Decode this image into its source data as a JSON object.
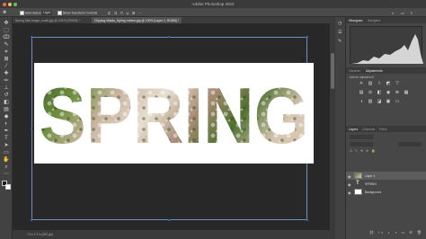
{
  "app": {
    "title": "Adobe Photoshop 2022"
  },
  "options_bar": {
    "auto_select_label": "Auto-Select:",
    "auto_select_value": "Layer",
    "transform_label": "Show Transform Controls"
  },
  "tabs": [
    {
      "label": "Spring Mist image_small.jpg @ 100% (RGB/8) *"
    },
    {
      "label": "Clipping Masks_Spring Letters.jpg @ 100% (Layer 1, RGB/8) *"
    }
  ],
  "document": {
    "text": "SPRING",
    "photo_fill_colors": [
      "#3c5a2a",
      "#6d8f3e",
      "#c9b3a0",
      "#e8dfd0",
      "#a98c74",
      "#4f7030",
      "#d7c6b2"
    ]
  },
  "status_bar": {
    "text": "7.5 x 2.2 in (300 ppi)"
  },
  "panels": {
    "histogram": {
      "tab1": "Histogram",
      "tab2": "Navigator"
    },
    "adjustments": {
      "tab1": "Libraries",
      "tab2": "Adjustments",
      "hint": "Add an adjustment"
    },
    "layers": {
      "tab1": "Layers",
      "tab2": "Channels",
      "tab3": "Paths",
      "rows": [
        {
          "name": "Layer 1"
        },
        {
          "name": "SPRING"
        },
        {
          "name": "Background"
        }
      ]
    }
  },
  "colors": {
    "accent": "#2a62c4",
    "canvas_bg": "#282828",
    "ui_bg": "#535353"
  }
}
